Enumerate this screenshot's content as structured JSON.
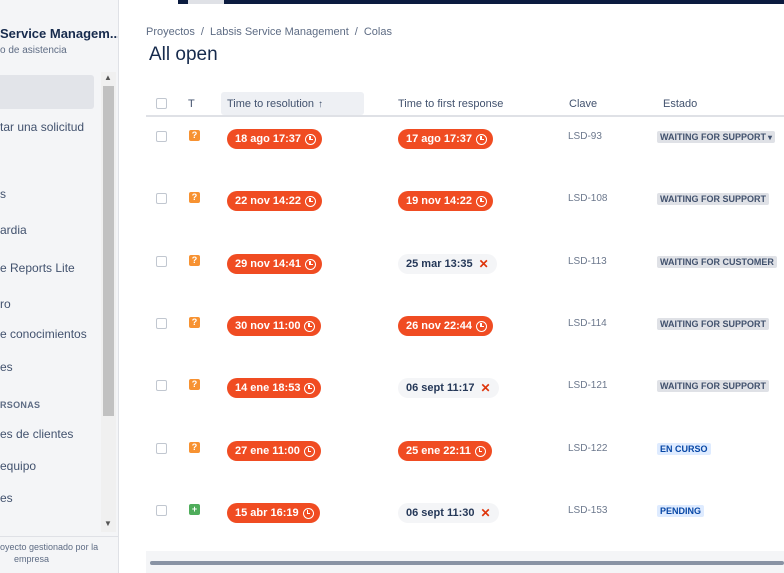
{
  "sidebar": {
    "project_name": "Service Managem...",
    "project_subtitle": "o de asistencia",
    "items": [
      {
        "label": "tar una solicitud"
      },
      {
        "label": "s"
      },
      {
        "label": "ardia"
      },
      {
        "label": "e Reports Lite"
      },
      {
        "label": "ro"
      },
      {
        "label": "e conocimientos"
      },
      {
        "label": "es"
      },
      {
        "label": "es de clientes"
      },
      {
        "label": "equipo"
      },
      {
        "label": "es"
      }
    ],
    "section_label": "RSONAS",
    "footer_line1": "oyecto gestionado por la",
    "footer_line2": "empresa"
  },
  "breadcrumb": {
    "items": [
      "Proyectos",
      "Labsis Service Management",
      "Colas"
    ],
    "separator": "/"
  },
  "page_title": "All open",
  "table": {
    "headers": {
      "type": "T",
      "time_to_resolution": "Time to resolution",
      "time_to_first_response": "Time to first response",
      "key": "Clave",
      "status": "Estado"
    },
    "sort_indicator": "↑",
    "rows": [
      {
        "type": "question",
        "type_glyph": "?",
        "resolution": "18 ago 17:37",
        "first_response": "17 ago 17:37",
        "first_response_breached": false,
        "key": "LSD-93",
        "status": "WAITING FOR SUPPORT",
        "status_color": "grey",
        "status_dropdown": true
      },
      {
        "type": "question",
        "type_glyph": "?",
        "resolution": "22 nov 14:22",
        "first_response": "19 nov 14:22",
        "first_response_breached": false,
        "key": "LSD-108",
        "status": "WAITING FOR SUPPORT",
        "status_color": "grey",
        "status_dropdown": false
      },
      {
        "type": "question",
        "type_glyph": "?",
        "resolution": "29 nov 14:41",
        "first_response": "25 mar 13:35",
        "first_response_breached": true,
        "key": "LSD-113",
        "status": "WAITING FOR CUSTOMER",
        "status_color": "grey",
        "status_dropdown": false
      },
      {
        "type": "question",
        "type_glyph": "?",
        "resolution": "30 nov 11:00",
        "first_response": "26 nov 22:44",
        "first_response_breached": false,
        "key": "LSD-114",
        "status": "WAITING FOR SUPPORT",
        "status_color": "grey",
        "status_dropdown": false
      },
      {
        "type": "question",
        "type_glyph": "?",
        "resolution": "14 ene 18:53",
        "first_response": "06 sept 11:17",
        "first_response_breached": true,
        "key": "LSD-121",
        "status": "WAITING FOR SUPPORT",
        "status_color": "grey",
        "status_dropdown": false
      },
      {
        "type": "question",
        "type_glyph": "?",
        "resolution": "27 ene 11:00",
        "first_response": "25 ene 22:11",
        "first_response_breached": false,
        "key": "LSD-122",
        "status": "EN CURSO",
        "status_color": "blue",
        "status_dropdown": false
      },
      {
        "type": "new-feature",
        "type_glyph": "+",
        "resolution": "15 abr 16:19",
        "first_response": "06 sept 11:30",
        "first_response_breached": true,
        "key": "LSD-153",
        "status": "PENDING",
        "status_color": "blue",
        "status_dropdown": false
      }
    ]
  },
  "colors": {
    "sla_breached": "#f04c22",
    "status_blue": "#deebff",
    "status_grey": "#dfe1e6"
  }
}
